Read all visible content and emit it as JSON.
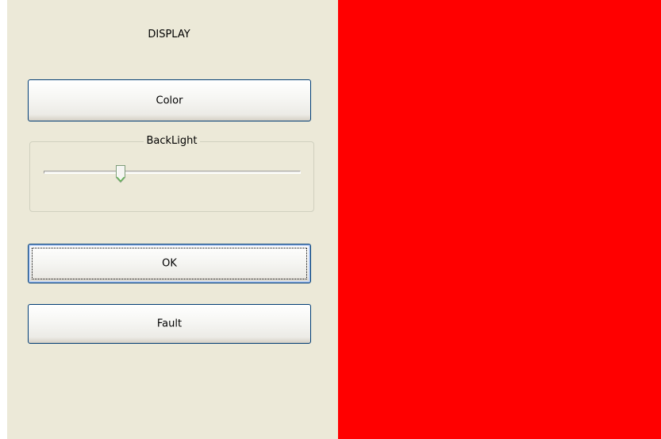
{
  "panel": {
    "title": "DISPLAY",
    "color_button_label": "Color",
    "backlight": {
      "label": "BackLight",
      "value": 0.3
    },
    "ok_button_label": "OK",
    "fault_button_label": "Fault"
  },
  "display": {
    "color": "#ff0000"
  },
  "colors": {
    "panel_background": "#ece9d8",
    "button_border": "#003c74"
  }
}
